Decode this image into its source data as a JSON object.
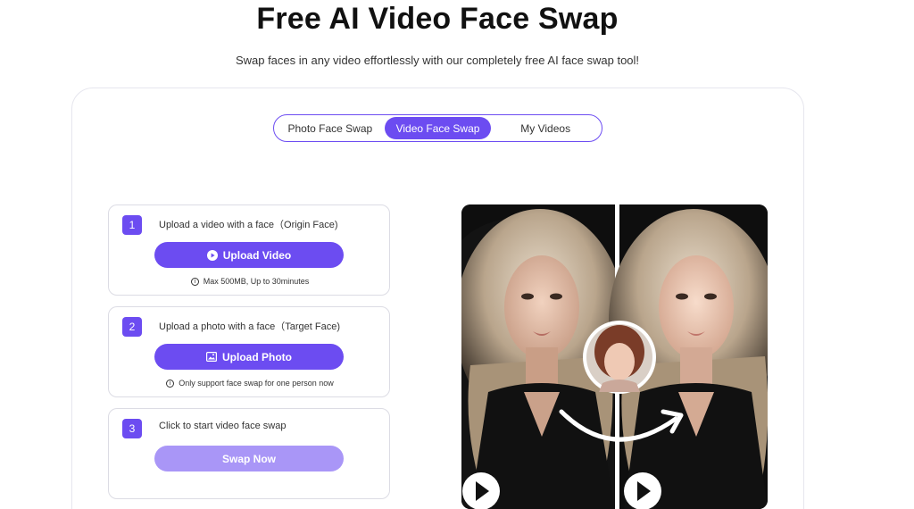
{
  "header": {
    "title": "Free AI Video Face Swap",
    "subtitle": "Swap faces in any video effortlessly with our completely free AI face swap tool!"
  },
  "tabs": [
    {
      "label": "Photo Face Swap",
      "active": false
    },
    {
      "label": "Video Face Swap",
      "active": true
    },
    {
      "label": "My Videos",
      "active": false
    }
  ],
  "steps": [
    {
      "number": "1",
      "text": "Upload a video with a face（Origin Face)",
      "button": "Upload Video",
      "button_icon": "play-circle-icon",
      "note": "Max 500MB, Up to 30minutes"
    },
    {
      "number": "2",
      "text": "Upload a photo with a face（Target Face)",
      "button": "Upload Photo",
      "button_icon": "image-icon",
      "note": "Only support face swap for one person now"
    },
    {
      "number": "3",
      "text": "Click to start video face swap",
      "button": "Swap Now",
      "button_disabled": true
    }
  ],
  "colors": {
    "accent": "#6c4cf1",
    "accent_disabled": "#a996f7",
    "border": "#dcdce4"
  }
}
